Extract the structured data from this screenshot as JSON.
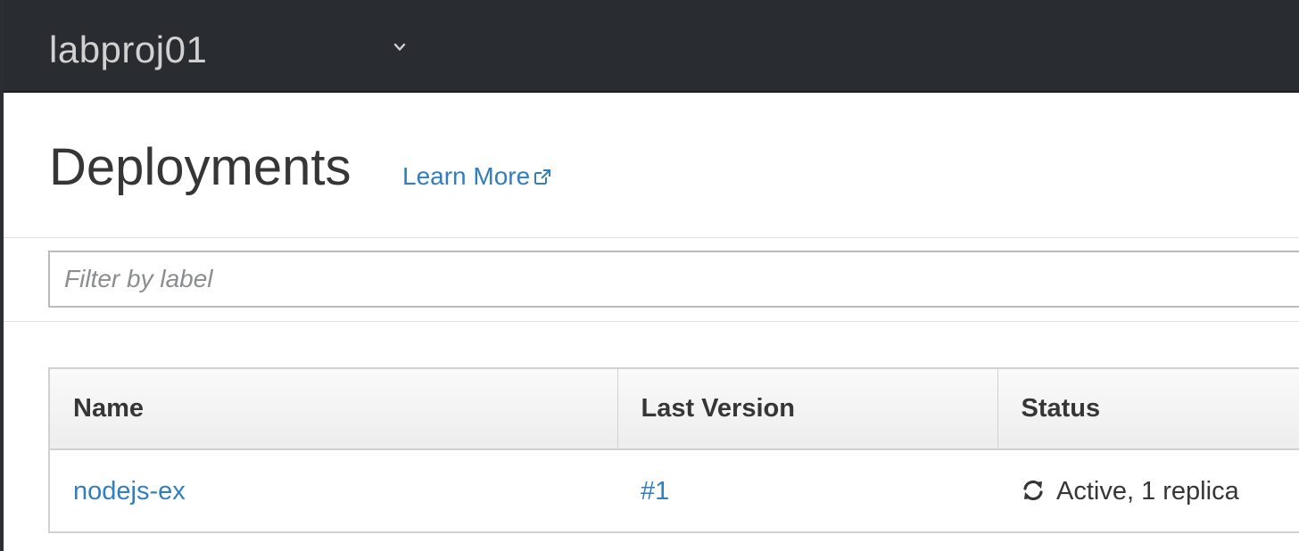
{
  "topbar": {
    "project_name": "labproj01"
  },
  "header": {
    "title": "Deployments",
    "learn_more": "Learn More"
  },
  "filter": {
    "placeholder": "Filter by label",
    "value": ""
  },
  "table": {
    "columns": [
      "Name",
      "Last Version",
      "Status"
    ],
    "rows": [
      {
        "name": "nodejs-ex",
        "last_version": "#1",
        "status": "Active, 1 replica",
        "status_icon": "sync-icon"
      }
    ]
  },
  "colors": {
    "topbar_bg": "#292c31",
    "link": "#2f7fc1",
    "text": "#363636"
  }
}
